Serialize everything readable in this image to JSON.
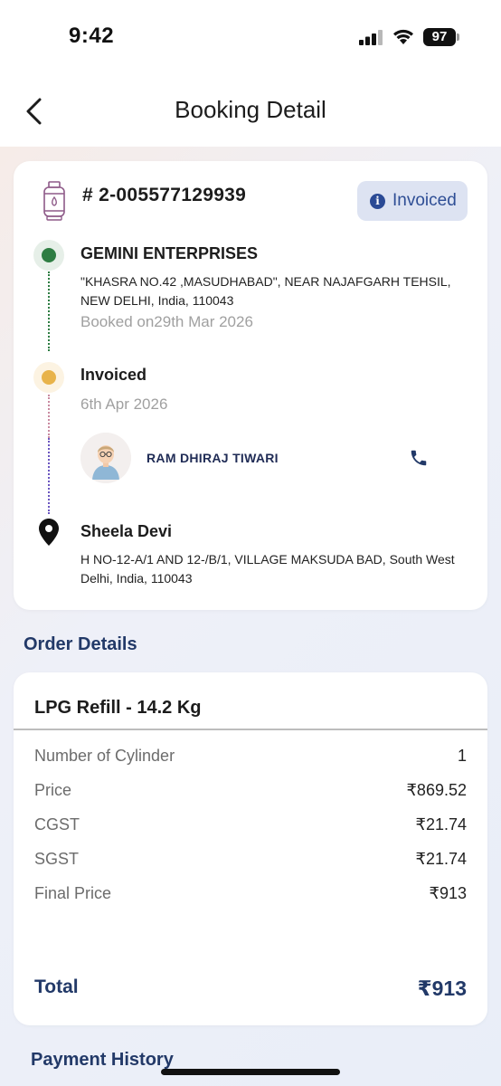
{
  "status_bar": {
    "time": "9:42",
    "battery": "97"
  },
  "header": {
    "title": "Booking Detail"
  },
  "booking": {
    "id": "# 2-005577129939",
    "status": "Invoiced",
    "distributor": {
      "name": "GEMINI ENTERPRISES",
      "address": "\"KHASRA NO.42 ,MASUDHABAD\", NEAR NAJAFGARH TEHSIL, NEW DELHI, India, 110043",
      "booked_on": "Booked on29th Mar 2026"
    },
    "invoiced": {
      "title": "Invoiced",
      "date": "6th Apr 2026"
    },
    "driver": {
      "name": "RAM DHIRAJ TIWARI"
    },
    "customer": {
      "name": "Sheela Devi",
      "address": "H NO-12-A/1 AND 12-/B/1, VILLAGE MAKSUDA BAD, South West Delhi, India, 110043"
    }
  },
  "order": {
    "heading": "Order Details",
    "product": "LPG Refill - 14.2 Kg",
    "rows": [
      {
        "label": "Number of Cylinder",
        "value": "1"
      },
      {
        "label": "Price",
        "value": "₹869.52"
      },
      {
        "label": "CGST",
        "value": "₹21.74"
      },
      {
        "label": "SGST",
        "value": "₹21.74"
      },
      {
        "label": "Final Price",
        "value": "₹913"
      }
    ],
    "total_label": "Total",
    "total_value": "₹913"
  },
  "payment": {
    "heading": "Payment History"
  },
  "colors": {
    "accent": "#223968",
    "green_dot": "#2e7d43",
    "yellow_dot": "#e8b34a",
    "badge_bg": "#dde3f2"
  }
}
